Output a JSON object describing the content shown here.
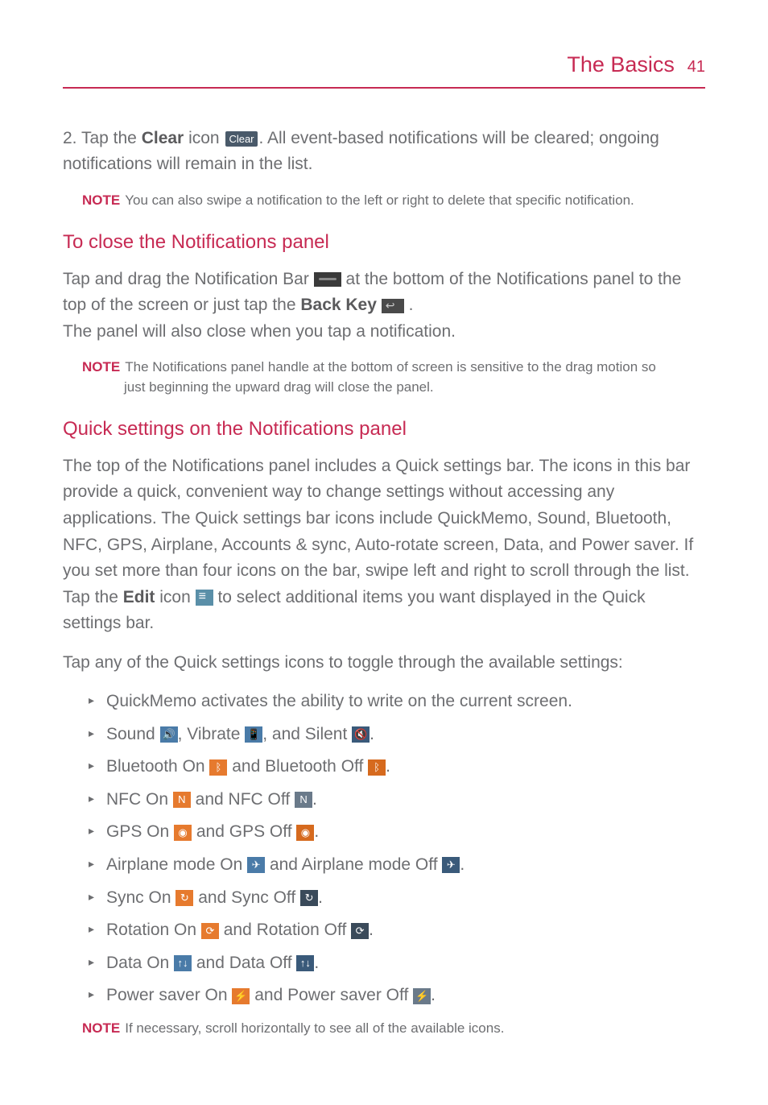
{
  "header": {
    "title": "The Basics",
    "page": "41"
  },
  "step2": {
    "prefix": "2.  Tap the ",
    "clear_label": "Clear",
    "mid": " icon ",
    "clear_icon_text": "Clear",
    "after": ". All event-based notifications will be cleared; ongoing notifications will remain in the list."
  },
  "note1": {
    "label": "NOTE",
    "text": "You can also swipe a notification to the left or right to delete that specific notification."
  },
  "section_close": {
    "title": "To close the Notifications panel",
    "p1_a": "Tap and drag the Notification Bar ",
    "p1_b": " at the bottom of the Notifications panel to the top of the screen or just tap the ",
    "backkey": "Back Key",
    "p1_c": " .",
    "p2": "The panel will also close when you tap a notification."
  },
  "note2": {
    "label": "NOTE",
    "text_a": "The Notifications panel handle at the bottom of screen is sensitive to the drag motion so",
    "text_b": "just beginning the upward drag will close the panel."
  },
  "section_quick": {
    "title": "Quick settings on the Notifications panel",
    "p1_a": "The top of the Notifications panel includes a Quick settings bar. The icons in this bar provide a quick, convenient way to change settings without accessing any applications. The Quick settings bar icons include QuickMemo, Sound, Bluetooth, NFC, GPS, Airplane, Accounts & sync, Auto-rotate screen, Data, and Power saver. If you set more than four icons on the bar, swipe left and right to scroll through the list. Tap the ",
    "edit_label": "Edit",
    "p1_b": " icon ",
    "p1_c": " to select additional items you want displayed in the Quick settings bar.",
    "p2": "Tap any of the Quick settings icons to toggle through the available settings:"
  },
  "list": {
    "quickmemo": "QuickMemo activates the ability to write on the current screen.",
    "sound_a": "Sound ",
    "sound_b": ", Vibrate ",
    "sound_c": ", and Silent ",
    "bt_a": "Bluetooth On ",
    "bt_b": " and Bluetooth Off ",
    "nfc_a": "NFC On ",
    "nfc_b": " and NFC Off ",
    "gps_a": "GPS On ",
    "gps_b": " and GPS Off ",
    "air_a": "Airplane mode On ",
    "air_b": " and Airplane mode Off ",
    "sync_a": "Sync On ",
    "sync_b": " and Sync Off ",
    "rot_a": "Rotation On ",
    "rot_b": " and Rotation Off ",
    "data_a": "Data On ",
    "data_b": " and Data Off ",
    "ps_a": "Power saver On ",
    "ps_b": " and Power saver Off ",
    "period": "."
  },
  "note3": {
    "label": "NOTE",
    "text": "If necessary, scroll horizontally to see all of the available icons."
  }
}
